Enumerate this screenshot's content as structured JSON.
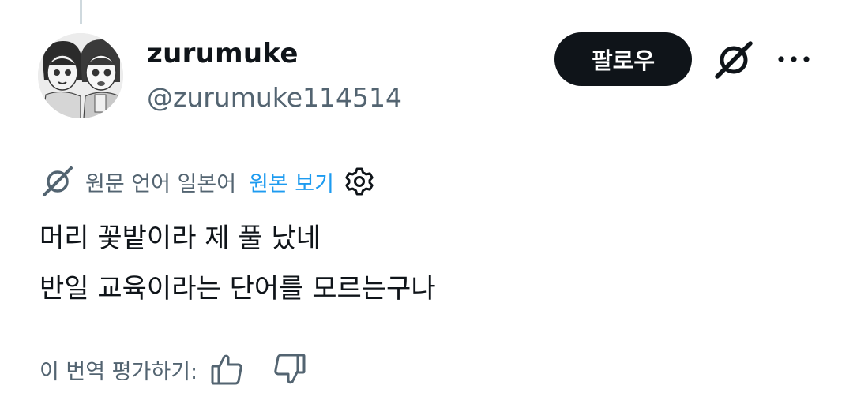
{
  "author": {
    "display_name": "zurumuke",
    "handle": "@zurumuke114514"
  },
  "header": {
    "follow_label": "팔로우"
  },
  "translation": {
    "language_note": "원문 언어 일본어",
    "show_original_label": "원본 보기"
  },
  "tweet": {
    "lines": [
      "머리 꽃밭이라 제 풀 났네",
      "반일 교육이라는 단어를 모르는구나"
    ]
  },
  "rating": {
    "prompt": "이 번역 평가하기:"
  },
  "icons": {
    "grok": "grok-icon",
    "more": "more-icon",
    "settings": "gear-icon",
    "thumbs_up": "thumbs-up-icon",
    "thumbs_down": "thumbs-down-icon"
  },
  "colors": {
    "text_primary": "#0f1419",
    "text_secondary": "#536471",
    "link": "#1d9bf0",
    "button_bg": "#0f1419"
  }
}
